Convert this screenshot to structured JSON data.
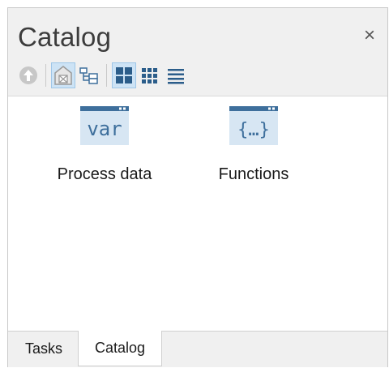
{
  "pane": {
    "title": "Catalog",
    "close_glyph": "×"
  },
  "toolbar": {
    "buttons": [
      {
        "icon": "up-arrow-icon",
        "enabled": false
      },
      {
        "icon": "home-icon",
        "enabled": true,
        "active": true
      },
      {
        "icon": "tree-view-icon",
        "enabled": true
      },
      {
        "icon": "large-icons-view-icon",
        "enabled": true,
        "active": true
      },
      {
        "icon": "small-icons-view-icon",
        "enabled": true
      },
      {
        "icon": "list-view-icon",
        "enabled": true
      }
    ]
  },
  "items": [
    {
      "label": "Process data",
      "icon": "variable-icon",
      "icon_text": "var"
    },
    {
      "label": "Functions",
      "icon": "function-braces-icon",
      "icon_text": "{…}"
    }
  ],
  "tabs": [
    {
      "label": "Tasks",
      "selected": false
    },
    {
      "label": "Catalog",
      "selected": true
    }
  ],
  "colors": {
    "accent": "#2b6ea8",
    "icon_bg": "#d7e6f3",
    "icon_bar": "#3e6f9c"
  }
}
